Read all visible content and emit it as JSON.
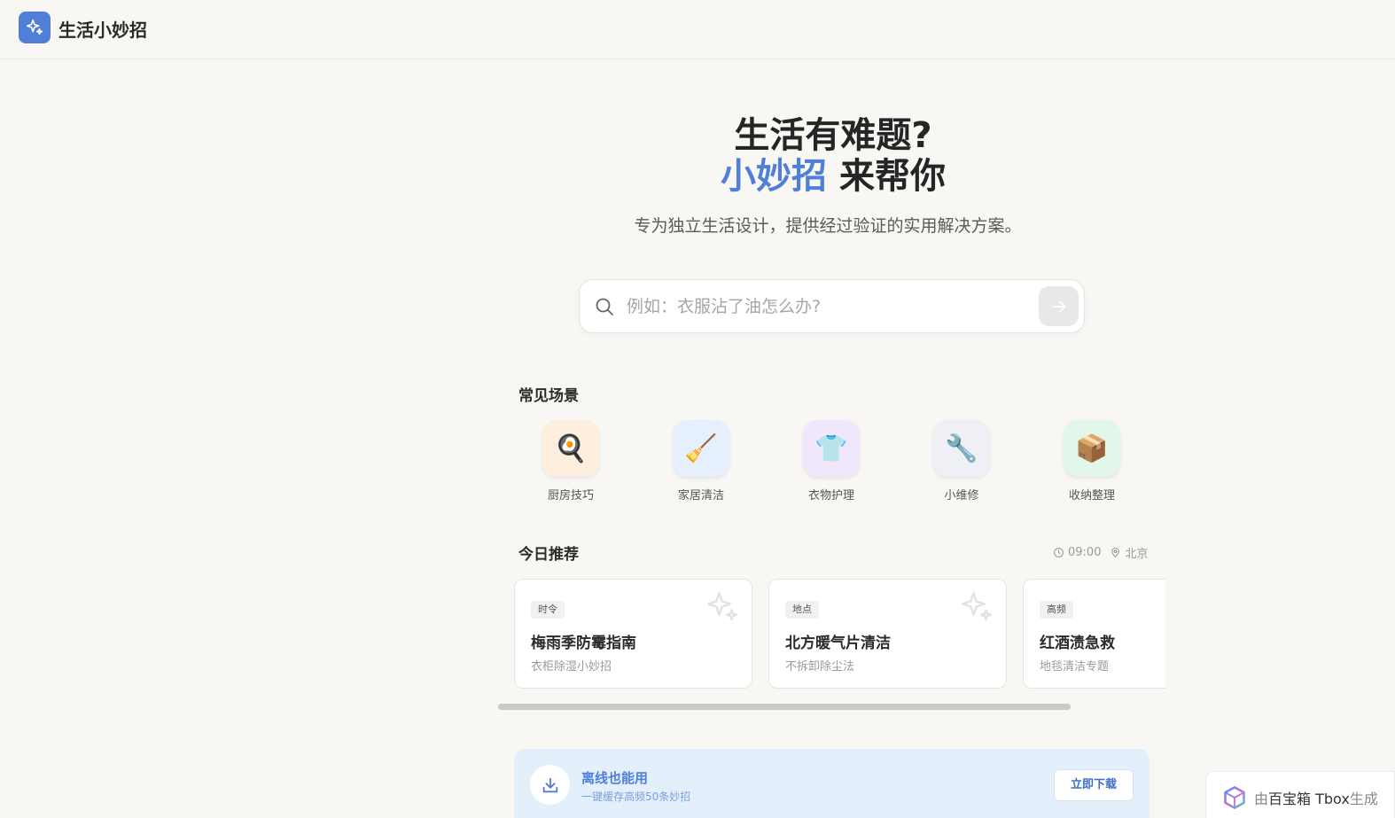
{
  "header": {
    "app_title": "生活小妙招",
    "logo_icon": "sparkle-icon"
  },
  "hero": {
    "line1": "生活有难题?",
    "line2_accent": "小妙招",
    "line2_rest": " 来帮你",
    "subtitle": "专为独立生活设计，提供经过验证的实用解决方案。"
  },
  "search": {
    "placeholder": "例如：衣服沾了油怎么办?",
    "value": ""
  },
  "scenes": {
    "title": "常见场景",
    "items": [
      {
        "label": "厨房技巧",
        "icon": "🍳",
        "bg": "#fdeedd"
      },
      {
        "label": "家居清洁",
        "icon": "🧹",
        "bg": "#e6effc"
      },
      {
        "label": "衣物护理",
        "icon": "👕",
        "bg": "#f1e7fb"
      },
      {
        "label": "小维修",
        "icon": "🔧",
        "bg": "#eef0f5"
      },
      {
        "label": "收纳整理",
        "icon": "📦",
        "bg": "#e2f6ea"
      }
    ]
  },
  "today": {
    "title": "今日推荐",
    "time": "09:00",
    "location": "北京",
    "cards": [
      {
        "tag": "时令",
        "title": "梅雨季防霉指南",
        "sub": "衣柜除湿小妙招"
      },
      {
        "tag": "地点",
        "title": "北方暖气片清洁",
        "sub": "不拆卸除尘法"
      },
      {
        "tag": "高频",
        "title": "红酒渍急救",
        "sub": "地毯清洁专题"
      }
    ]
  },
  "offline": {
    "title": "离线也能用",
    "sub": "一键缓存高频50条妙招",
    "button": "立即下载"
  },
  "badge": {
    "prefix": "由 ",
    "brand": "百宝箱 Tbox",
    "suffix": " 生成"
  }
}
